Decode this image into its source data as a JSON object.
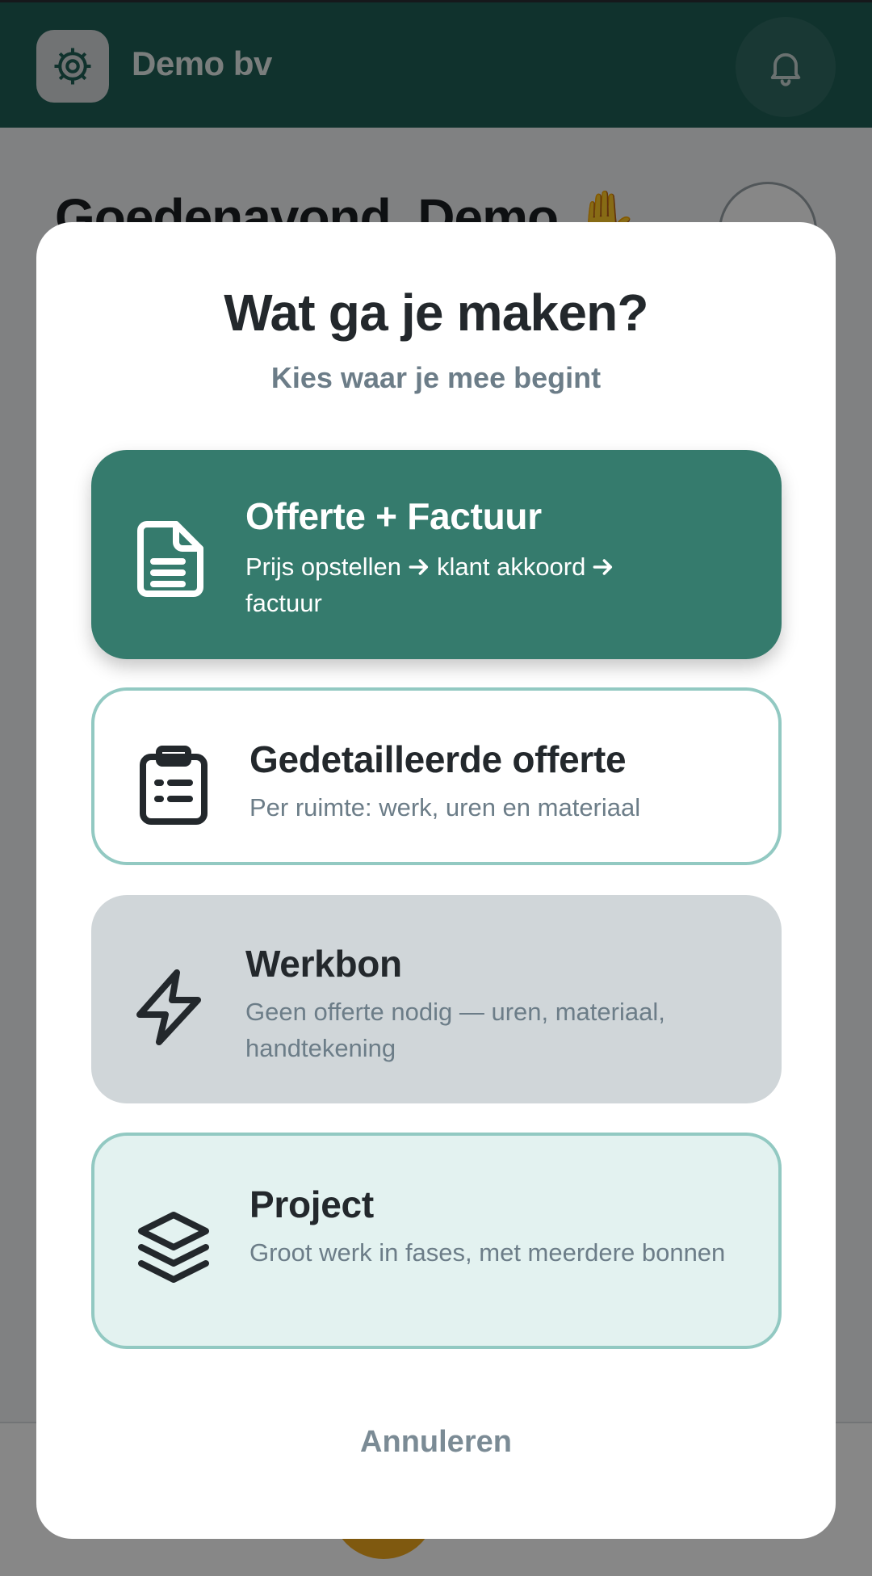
{
  "app": {
    "company_name": "Demo bv",
    "greeting": "Goedenavond, Demo",
    "greeting_emoji": "✋"
  },
  "icons": {
    "logo": "gear-logo-icon",
    "notifications": "bell-icon",
    "quote_invoice": "document-icon",
    "detailed_quote": "clipboard-list-icon",
    "work_order": "lightning-icon",
    "project": "layers-icon"
  },
  "colors": {
    "header": "#1f5f55",
    "primary_option": "#357b6d",
    "option_border": "#92c9c2",
    "fab": "#f0a81d"
  },
  "modal": {
    "title": "Wat ga je maken?",
    "subtitle": "Kies waar je mee begint",
    "cancel_label": "Annuleren",
    "options": [
      {
        "title": "Offerte + Factuur",
        "desc_parts": [
          "Prijs opstellen",
          "klant akkoord",
          "factuur"
        ]
      },
      {
        "title": "Gedetailleerde offerte",
        "desc": "Per ruimte: werk, uren en materiaal"
      },
      {
        "title": "Werkbon",
        "desc": "Geen offerte nodig — uren, materiaal, handtekening"
      },
      {
        "title": "Project",
        "desc": "Groot werk in fases, met meerdere bonnen"
      }
    ]
  }
}
